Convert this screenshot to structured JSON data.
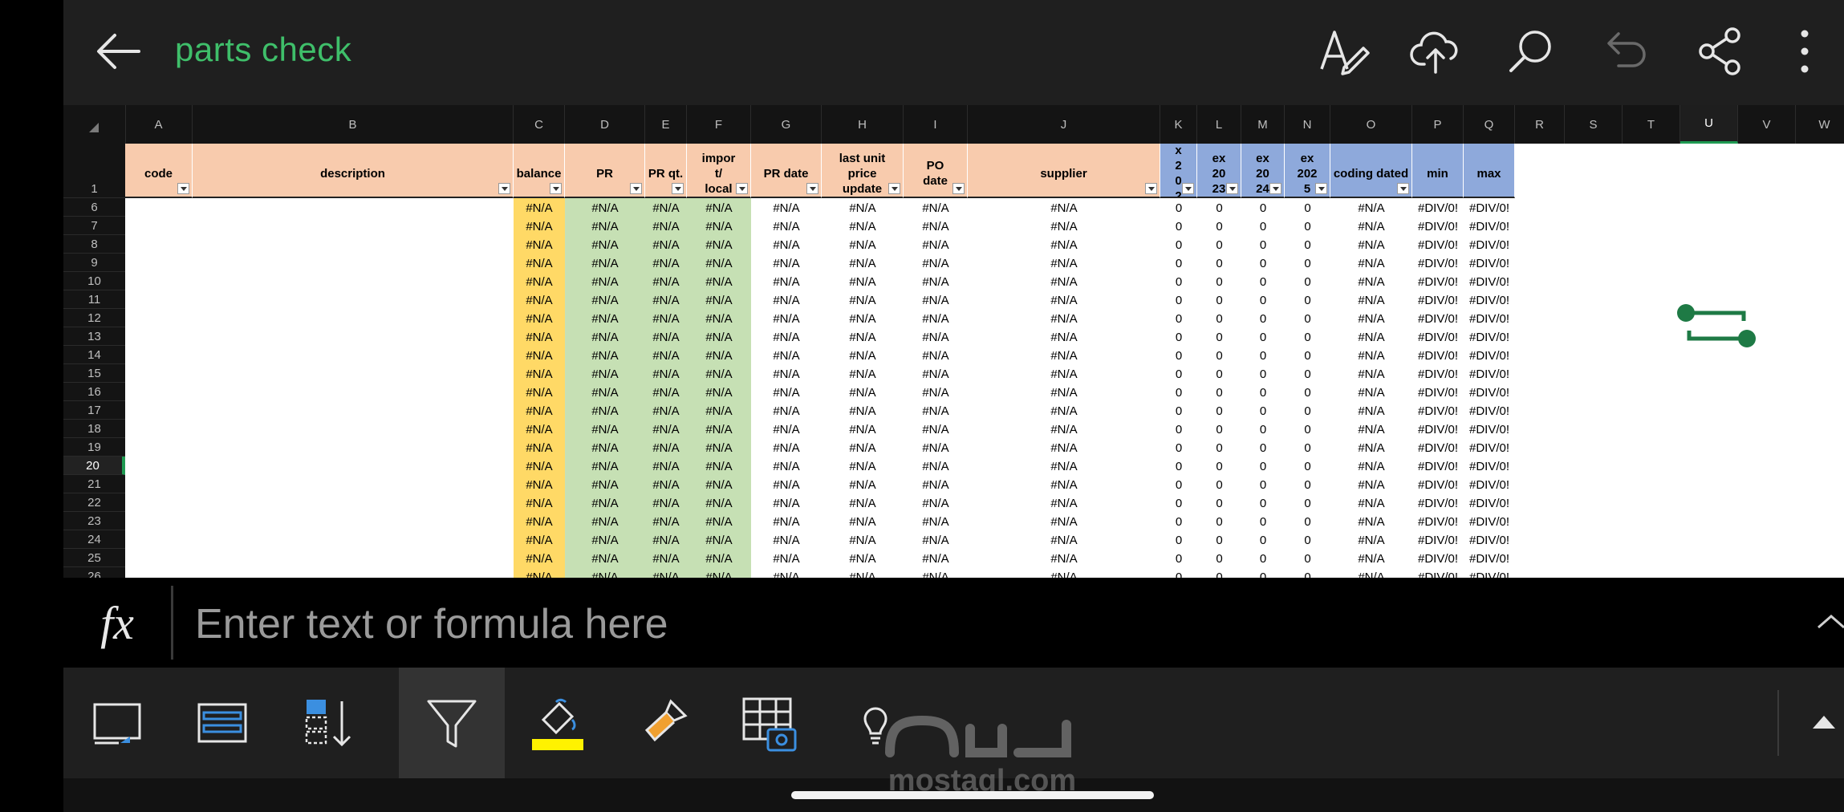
{
  "app": {
    "title": "parts check"
  },
  "toolbar_top": {
    "icons": [
      "back-arrow-icon",
      "draw-icon",
      "cloud-upload-icon",
      "search-icon",
      "undo-icon",
      "share-icon",
      "more-vertical-icon"
    ]
  },
  "colors": {
    "accent_green": "#3fbf6a",
    "peach": "#f8cbad",
    "yellow": "#ffd966",
    "green_band": "#c6e0b4",
    "blue_header": "#8ea9db"
  },
  "columns": [
    "A",
    "B",
    "C",
    "D",
    "E",
    "F",
    "G",
    "H",
    "I",
    "J",
    "K",
    "L",
    "M",
    "N",
    "O",
    "P",
    "Q",
    "R",
    "S",
    "T",
    "U",
    "V",
    "W"
  ],
  "selected_column": "U",
  "rows": [
    "1",
    "6",
    "7",
    "8",
    "9",
    "10",
    "11",
    "12",
    "13",
    "14",
    "15",
    "16",
    "17",
    "18",
    "19",
    "20",
    "21",
    "22",
    "23",
    "24",
    "25",
    "26"
  ],
  "selected_row": "20",
  "headers": [
    "code",
    "description",
    "balance",
    "PR",
    "PR qt.",
    "impor\nt/\nlocal",
    "PR date",
    "last unit\nprice\nupdate",
    "PO\ndate",
    "supplier",
    "x\n2\n0\n2",
    "ex\n20\n23",
    "ex\n20\n24",
    "ex\n202\n5",
    "coding dated",
    "min",
    "max"
  ],
  "row_values": [
    "#N/A",
    "#N/A",
    "#N/A",
    "#N/A",
    "#N/A",
    "#N/A",
    "#N/A",
    "#N/A",
    "0",
    "0",
    "0",
    "0",
    "#N/A",
    "#DIV/0!",
    "#DIV/0!"
  ],
  "formula_bar": {
    "label": "fx",
    "placeholder": "Enter text or formula here"
  },
  "bottom_toolbar": {
    "icons": [
      "freeze-panes-icon",
      "table-style-icon",
      "sort-icon",
      "filter-icon",
      "fill-color-icon",
      "format-painter-icon",
      "table-snapshot-icon",
      "lightbulb-icon"
    ]
  },
  "watermark": {
    "text": "mostaql.com"
  }
}
